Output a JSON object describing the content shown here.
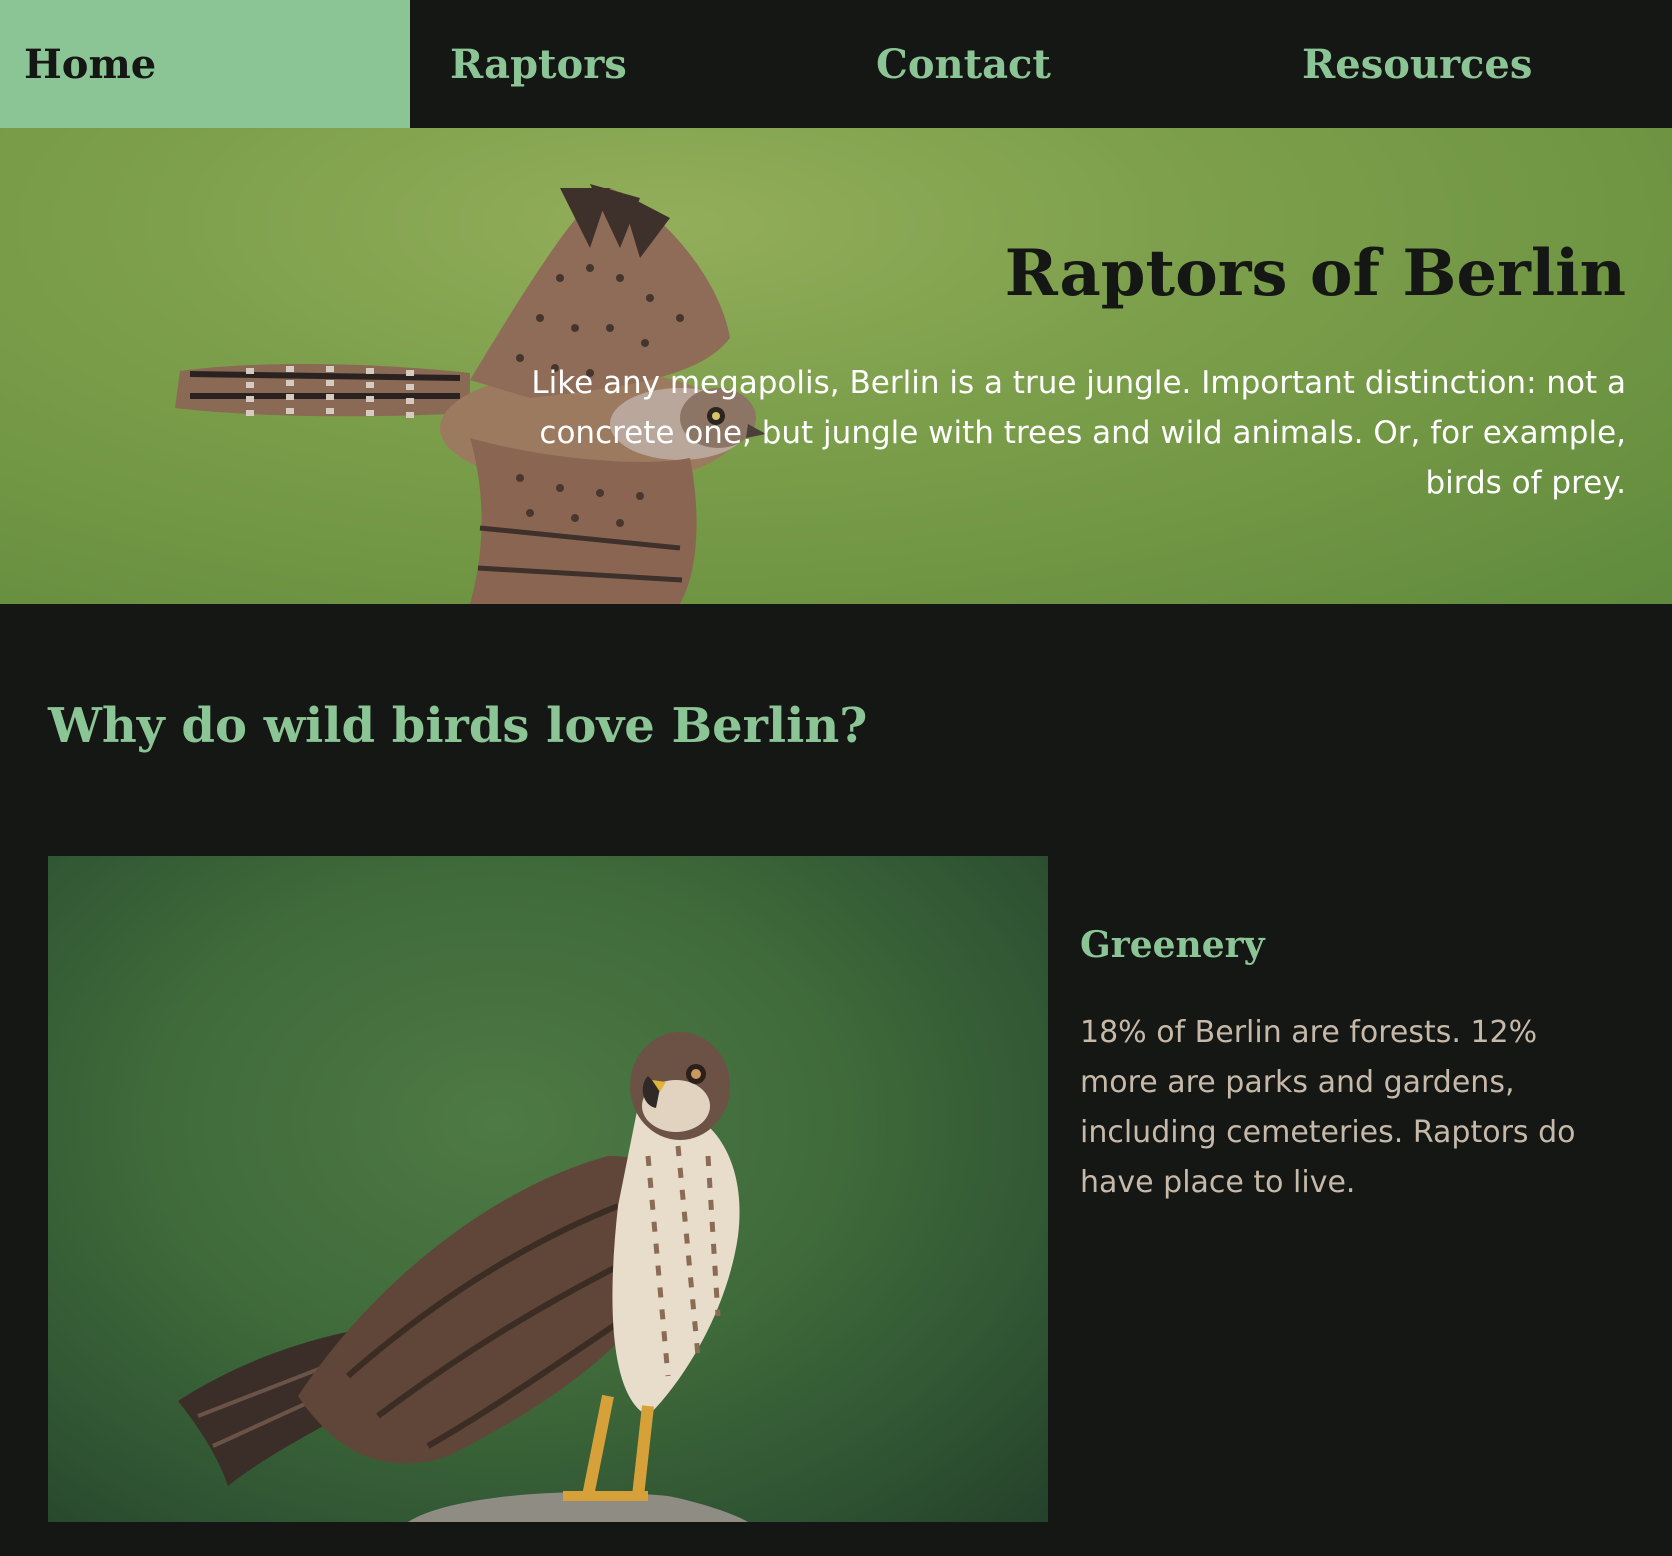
{
  "nav": {
    "items": [
      {
        "label": "Home",
        "active": true
      },
      {
        "label": "Raptors",
        "active": false
      },
      {
        "label": "Contact",
        "active": false
      },
      {
        "label": "Resources",
        "active": false
      }
    ]
  },
  "hero": {
    "title": "Raptors of Berlin",
    "text": "Like any megapolis, Berlin is a true jungle. Important distinction: not a concrete one, but jungle with trees and wild animals. Or, for example, birds of prey."
  },
  "section": {
    "title": "Why do wild birds love Berlin?"
  },
  "card": {
    "title": "Greenery",
    "text": "18% of Berlin are forests. 12% more are parks and gardens, including cemeteries. Raptors do have place to live."
  },
  "colors": {
    "accent": "#8cc595",
    "background": "#151714",
    "body_text": "#c6b9a9"
  }
}
